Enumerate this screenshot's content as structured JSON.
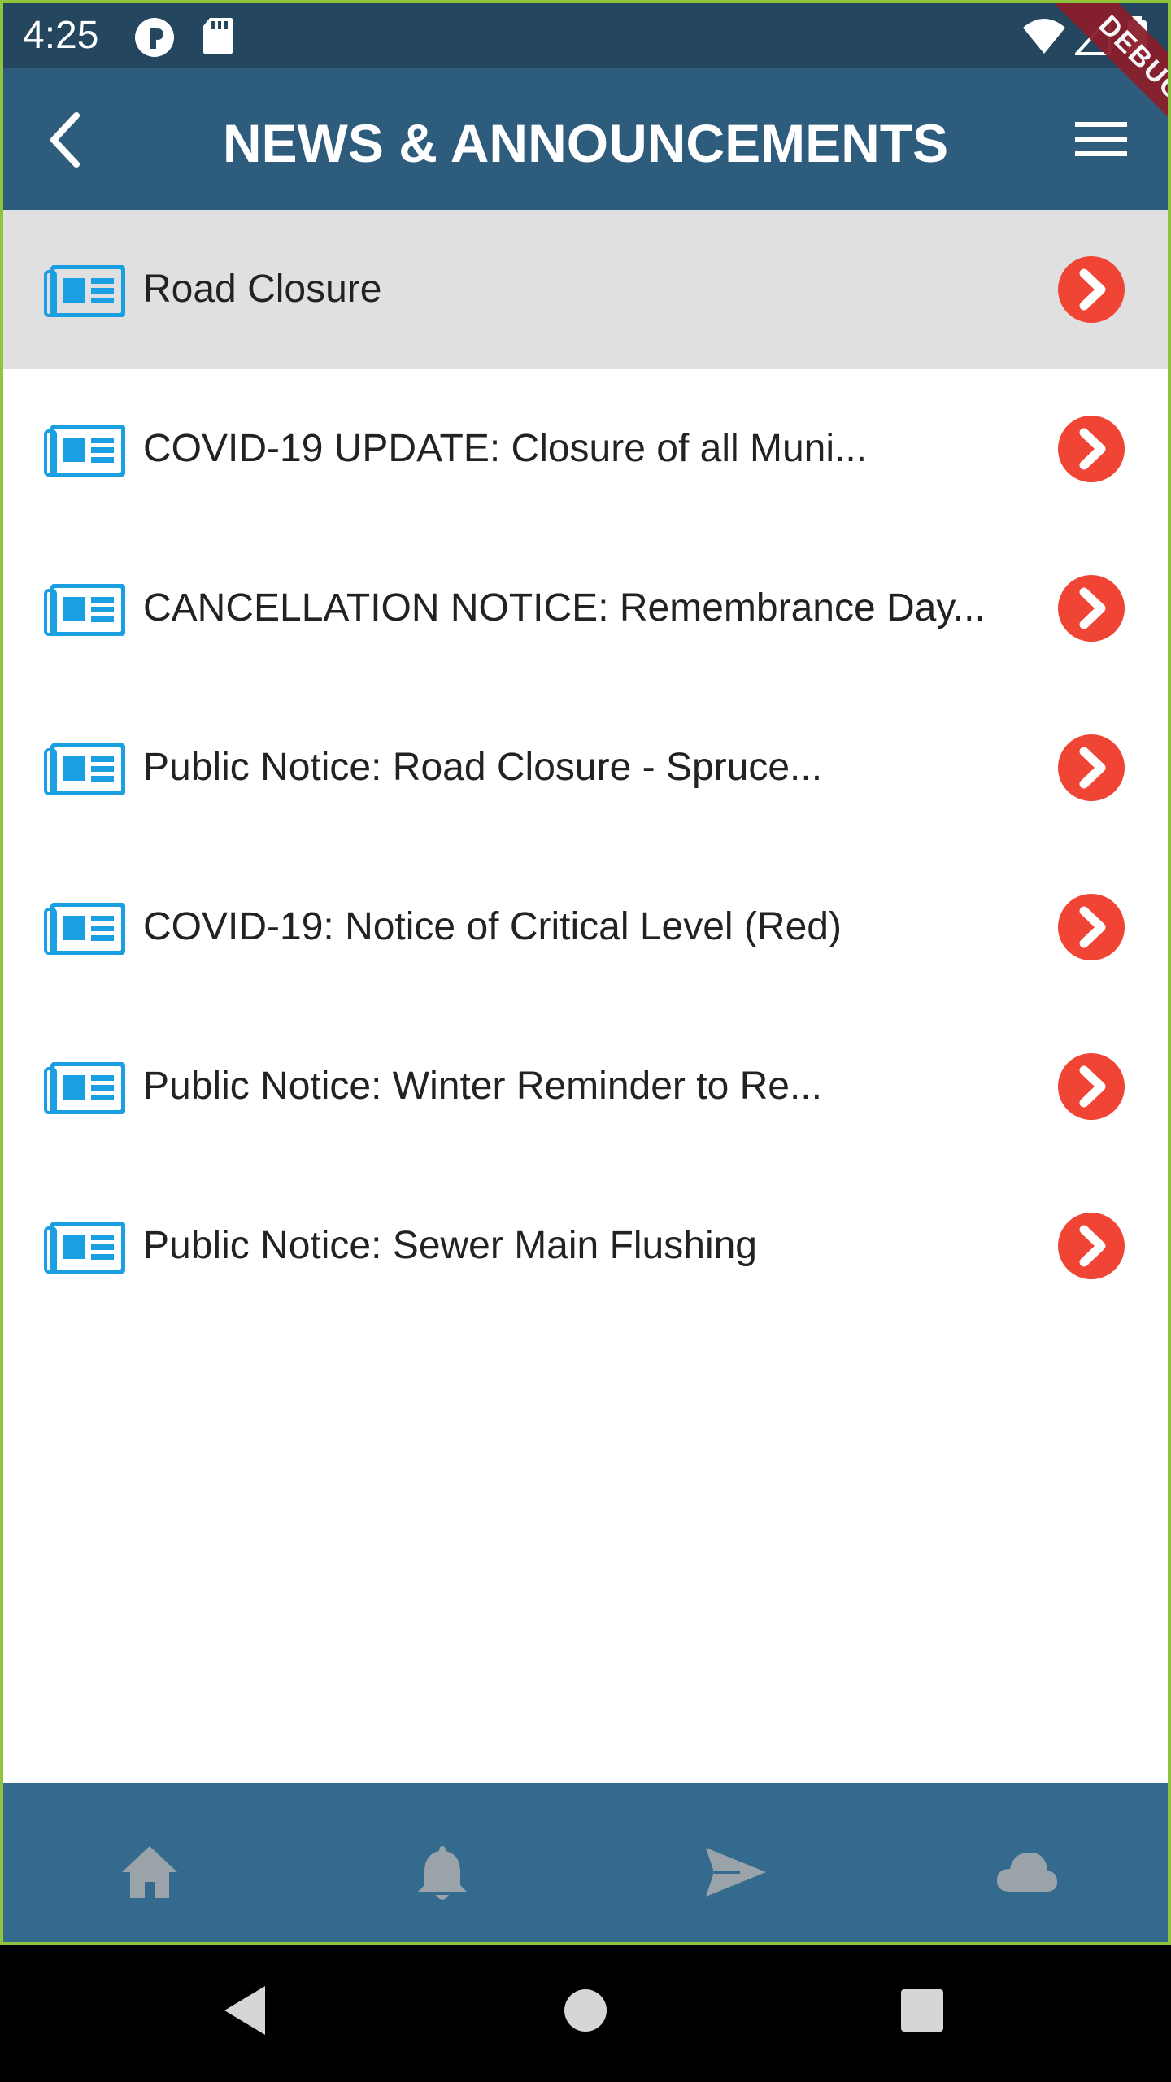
{
  "status_bar": {
    "time": "4:25",
    "icons": [
      "app-notification-icon",
      "sd-card-icon",
      "wifi-icon",
      "cellular-signal-icon",
      "battery-icon"
    ]
  },
  "app_bar": {
    "title": "NEWS & ANNOUNCEMENTS",
    "back_icon": "chevron-left-icon",
    "menu_icon": "hamburger-menu-icon",
    "debug_banner": "DEBUG",
    "background_color": "#2d5c7d"
  },
  "news": {
    "selected_index": 0,
    "item_icon": "newspaper-icon",
    "item_icon_color": "#1a9fe3",
    "arrow_color": "#f04435",
    "items": [
      {
        "label": "Road Closure"
      },
      {
        "label": "COVID-19 UPDATE: Closure of all Muni..."
      },
      {
        "label": "CANCELLATION NOTICE: Remembrance Day..."
      },
      {
        "label": "Public Notice: Road Closure - Spruce..."
      },
      {
        "label": "COVID-19: Notice of Critical Level (Red)"
      },
      {
        "label": "Public Notice: Winter Reminder to Re..."
      },
      {
        "label": "Public Notice: Sewer Main Flushing"
      }
    ]
  },
  "bottom_nav": {
    "background_color": "#336a8d",
    "icon_color": "#9aa3aa",
    "items": [
      "home-icon",
      "bell-icon",
      "send-icon",
      "cloud-icon"
    ]
  },
  "system_nav": {
    "items": [
      "back-triangle-icon",
      "home-circle-icon",
      "recents-square-icon"
    ]
  }
}
